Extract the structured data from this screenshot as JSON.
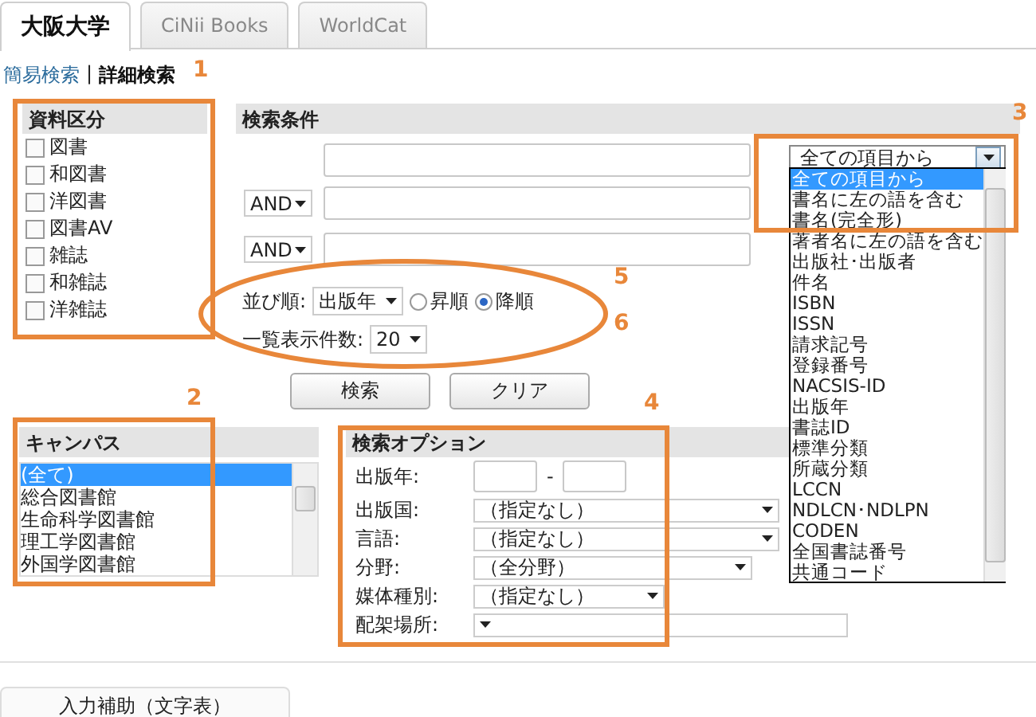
{
  "tabs": [
    {
      "label": "大阪大学",
      "selected": true
    },
    {
      "label": "CiNii Books",
      "selected": false
    },
    {
      "label": "WorldCat",
      "selected": false
    }
  ],
  "mode_links": {
    "items": [
      {
        "label": "簡易検索",
        "selected": false
      },
      {
        "label": "詳細検索",
        "selected": true
      }
    ],
    "separator": "|"
  },
  "material_types": {
    "title": "資料区分",
    "items": [
      {
        "label": "図書",
        "checked": false
      },
      {
        "label": "和図書",
        "checked": false
      },
      {
        "label": "洋図書",
        "checked": false
      },
      {
        "label": "図書AV",
        "checked": false
      },
      {
        "label": "雑誌",
        "checked": false
      },
      {
        "label": "和雑誌",
        "checked": false
      },
      {
        "label": "洋雑誌",
        "checked": false
      }
    ]
  },
  "search_conditions": {
    "title": "検索条件",
    "rows": [
      {
        "operator": null
      },
      {
        "operator": "AND"
      },
      {
        "operator": "AND"
      }
    ],
    "field_select": {
      "value": "全ての項目から",
      "expanded": true,
      "options": [
        {
          "label": "全ての項目から",
          "selected": true
        },
        {
          "label": "書名に左の語を含む",
          "selected": false
        },
        {
          "label": "書名(完全形)",
          "selected": false
        },
        {
          "label": "著者名に左の語を含む",
          "selected": false
        },
        {
          "label": "出版社･出版者",
          "selected": false
        },
        {
          "label": "件名",
          "selected": false
        },
        {
          "label": "ISBN",
          "selected": false
        },
        {
          "label": "ISSN",
          "selected": false
        },
        {
          "label": "請求記号",
          "selected": false
        },
        {
          "label": "登録番号",
          "selected": false
        },
        {
          "label": "NACSIS-ID",
          "selected": false
        },
        {
          "label": "出版年",
          "selected": false
        },
        {
          "label": "書誌ID",
          "selected": false
        },
        {
          "label": "標準分類",
          "selected": false
        },
        {
          "label": "所蔵分類",
          "selected": false
        },
        {
          "label": "LCCN",
          "selected": false
        },
        {
          "label": "NDLCN･NDLPN",
          "selected": false
        },
        {
          "label": "CODEN",
          "selected": false
        },
        {
          "label": "全国書誌番号",
          "selected": false
        },
        {
          "label": "共通コード",
          "selected": false
        }
      ]
    },
    "sort": {
      "label": "並び順:",
      "value": "出版年",
      "orders": [
        {
          "label": "昇順",
          "selected": false
        },
        {
          "label": "降順",
          "selected": true
        }
      ]
    },
    "page_size": {
      "label": "一覧表示件数:",
      "value": "20"
    }
  },
  "buttons": [
    "検索",
    "クリア"
  ],
  "campus": {
    "title": "キャンパス",
    "items": [
      {
        "label": "(全て)",
        "selected": true
      },
      {
        "label": "総合図書館",
        "selected": false
      },
      {
        "label": "生命科学図書館",
        "selected": false
      },
      {
        "label": "理工学図書館",
        "selected": false
      },
      {
        "label": "外国学図書館",
        "selected": false
      }
    ]
  },
  "search_options": {
    "title": "検索オプション",
    "fields": [
      {
        "label": "出版年:",
        "kind": "range",
        "separator": "-"
      },
      {
        "label": "出版国:",
        "kind": "select",
        "value": "（指定なし）"
      },
      {
        "label": "言語:",
        "kind": "select",
        "value": "（指定なし）"
      },
      {
        "label": "分野:",
        "kind": "select",
        "value": "（全分野）"
      },
      {
        "label": "媒体種別:",
        "kind": "select",
        "value": "（指定なし）"
      },
      {
        "label": "配架場所:",
        "kind": "select"
      }
    ]
  },
  "annotations": [
    {
      "label": "1",
      "kind": "box"
    },
    {
      "label": "2",
      "kind": "box"
    },
    {
      "label": "3",
      "kind": "box"
    },
    {
      "label": "4",
      "kind": "box"
    },
    {
      "label": "5",
      "kind": "ellipse"
    },
    {
      "label": "6",
      "kind": "none"
    }
  ],
  "footer_tab": {
    "label": "入力補助（文字表）"
  }
}
